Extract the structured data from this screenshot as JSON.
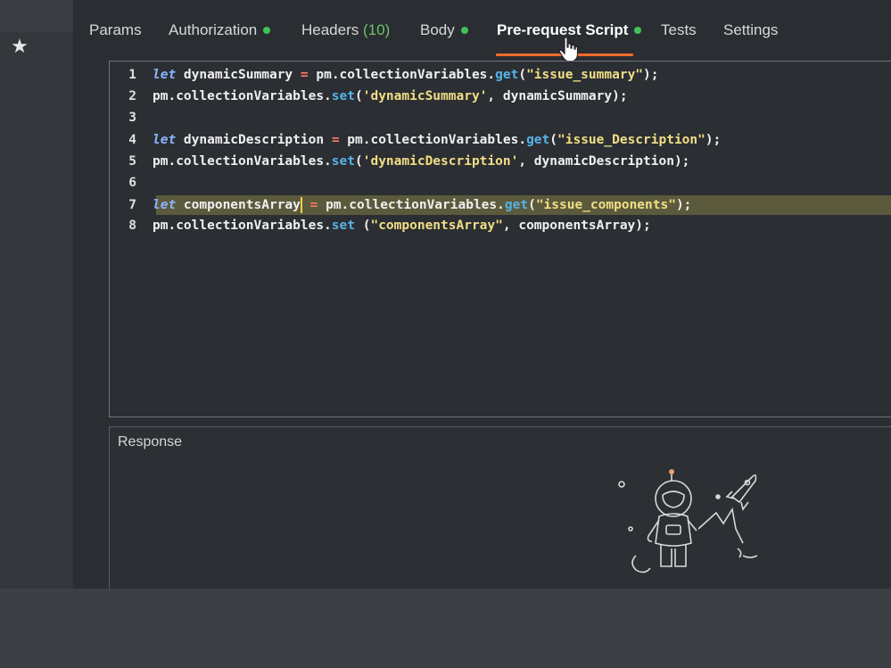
{
  "sidebar": {
    "star_icon": "star-icon"
  },
  "tabs": [
    {
      "label": "Params"
    },
    {
      "label": "Authorization",
      "dot": true
    },
    {
      "label": "Headers",
      "count": "(10)"
    },
    {
      "label": "Body",
      "dot": true
    },
    {
      "label": "Pre-request Script",
      "dot": true,
      "active": true
    },
    {
      "label": "Tests"
    },
    {
      "label": "Settings"
    }
  ],
  "editor": {
    "lines": [
      {
        "n": "1",
        "code": "let dynamicSummary = pm.collectionVariables.get(\"issue_summary\");"
      },
      {
        "n": "2",
        "code": "pm.collectionVariables.set('dynamicSummary', dynamicSummary);"
      },
      {
        "n": "3",
        "code": ""
      },
      {
        "n": "4",
        "code": "let dynamicDescription = pm.collectionVariables.get(\"issue_Description\");"
      },
      {
        "n": "5",
        "code": "pm.collectionVariables.set('dynamicDescription', dynamicDescription);"
      },
      {
        "n": "6",
        "code": ""
      },
      {
        "n": "7",
        "code": "let componentsArray = pm.collectionVariables.get(\"issue_components\");"
      },
      {
        "n": "8",
        "code": "pm.collectionVariables.set (\"componentsArray\", componentsArray);"
      }
    ],
    "highlighted_line": "7"
  },
  "response": {
    "title": "Response",
    "illustration": "astronaut-rocket-illustration"
  },
  "colors": {
    "active_tab_underline": "#f26b2c",
    "status_dot": "#41c25a",
    "keyword": "#8ab4ff",
    "method": "#57b3e6",
    "string": "#f2df85"
  }
}
